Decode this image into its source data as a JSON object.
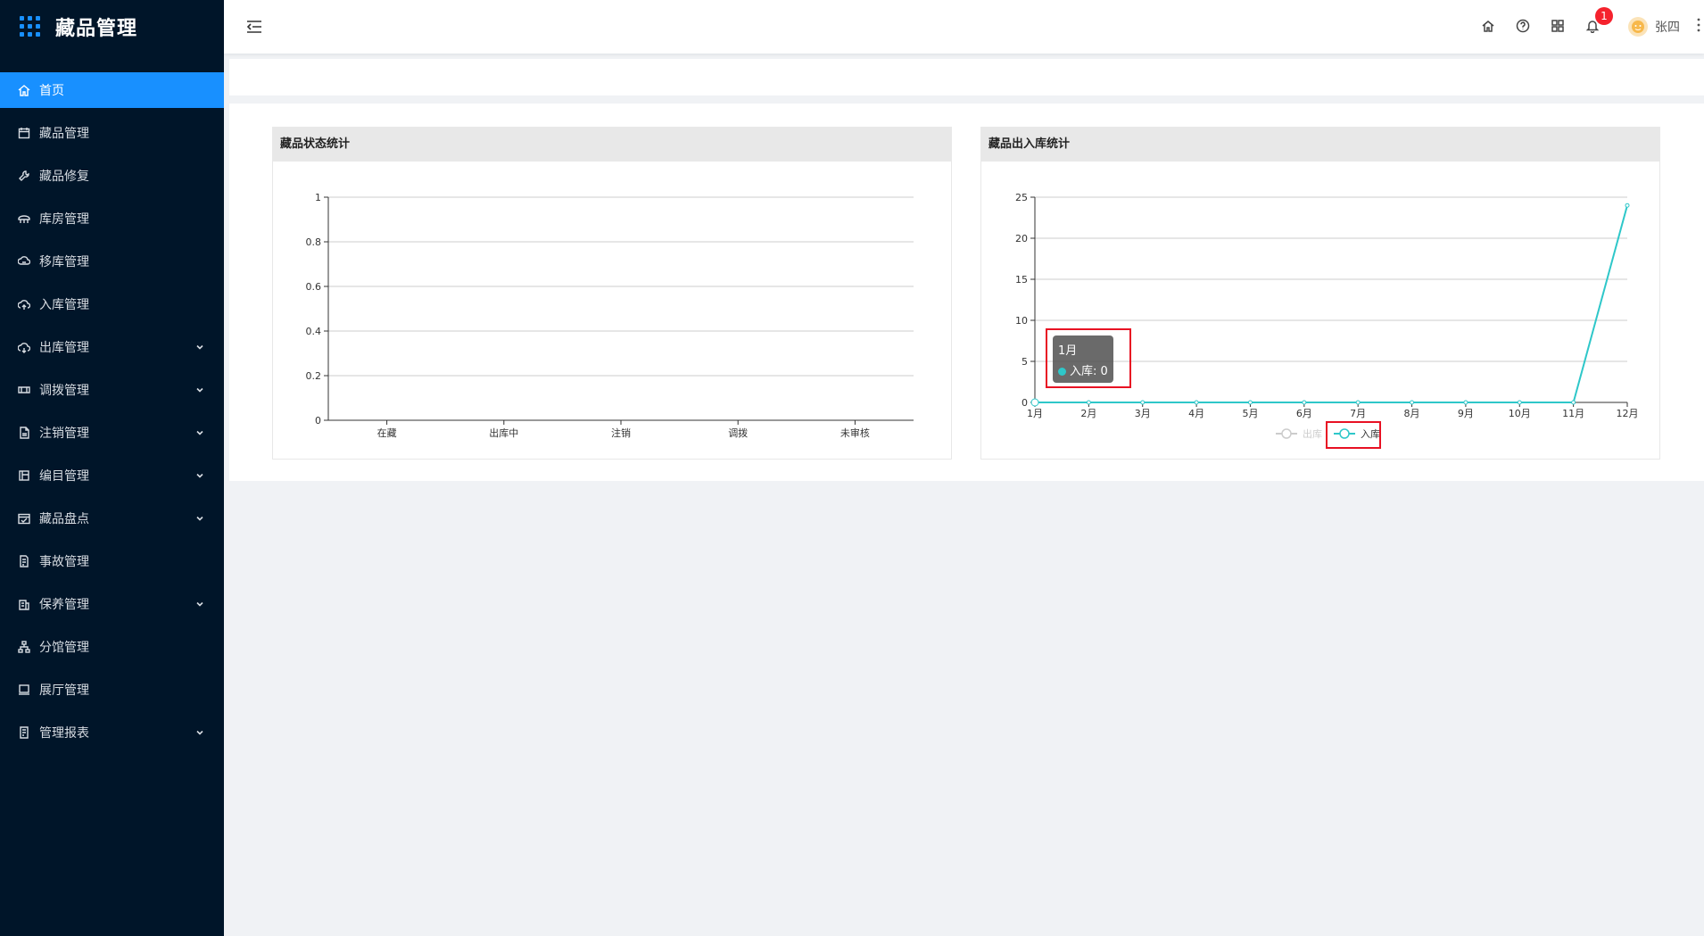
{
  "app": {
    "title": "藏品管理"
  },
  "sidebar": {
    "items": [
      {
        "label": "首页",
        "icon": "home-icon",
        "active": true,
        "expandable": false
      },
      {
        "label": "藏品管理",
        "icon": "calendar-icon",
        "active": false,
        "expandable": false
      },
      {
        "label": "藏品修复",
        "icon": "wrench-icon",
        "active": false,
        "expandable": false
      },
      {
        "label": "库房管理",
        "icon": "warehouse-icon",
        "active": false,
        "expandable": false
      },
      {
        "label": "移库管理",
        "icon": "transfer-cloud-icon",
        "active": false,
        "expandable": false
      },
      {
        "label": "入库管理",
        "icon": "cloud-upload-icon",
        "active": false,
        "expandable": false
      },
      {
        "label": "出库管理",
        "icon": "cloud-download-icon",
        "active": false,
        "expandable": true
      },
      {
        "label": "调拨管理",
        "icon": "swap-icon",
        "active": false,
        "expandable": true
      },
      {
        "label": "注销管理",
        "icon": "document-icon",
        "active": false,
        "expandable": true
      },
      {
        "label": "编目管理",
        "icon": "catalog-icon",
        "active": false,
        "expandable": true
      },
      {
        "label": "藏品盘点",
        "icon": "inventory-icon",
        "active": false,
        "expandable": true
      },
      {
        "label": "事故管理",
        "icon": "incident-icon",
        "active": false,
        "expandable": false
      },
      {
        "label": "保养管理",
        "icon": "maintenance-icon",
        "active": false,
        "expandable": true
      },
      {
        "label": "分馆管理",
        "icon": "branch-icon",
        "active": false,
        "expandable": false
      },
      {
        "label": "展厅管理",
        "icon": "display-icon",
        "active": false,
        "expandable": false
      },
      {
        "label": "管理报表",
        "icon": "report-icon",
        "active": false,
        "expandable": true
      }
    ]
  },
  "header": {
    "icons": [
      "home-icon",
      "help-icon",
      "apps-icon",
      "bell-icon"
    ],
    "notification_count": "1",
    "username": "张四"
  },
  "colors": {
    "sidebar_bg": "#001529",
    "accent": "#1890ff",
    "series_in": "#2ec7c9",
    "highlight": "#e81123"
  },
  "cards": {
    "status": {
      "title": "藏品状态统计"
    },
    "inout": {
      "title": "藏品出入库统计"
    }
  },
  "chart_data": [
    {
      "type": "bar",
      "title": "藏品状态统计",
      "categories": [
        "在藏",
        "出库中",
        "注销",
        "调拨",
        "未审核"
      ],
      "values": [
        0,
        0,
        0,
        0,
        0
      ],
      "yticks": [
        "0",
        "0.2",
        "0.4",
        "0.6",
        "0.8",
        "1"
      ],
      "ylim": [
        0,
        1
      ],
      "grid": true
    },
    {
      "type": "line",
      "title": "藏品出入库统计",
      "categories": [
        "1月",
        "2月",
        "3月",
        "4月",
        "5月",
        "6月",
        "7月",
        "8月",
        "9月",
        "10月",
        "11月",
        "12月"
      ],
      "yticks": [
        "0",
        "5",
        "10",
        "15",
        "20",
        "25"
      ],
      "ylim": [
        0,
        25
      ],
      "grid": true,
      "legend": "bottom-center",
      "series": [
        {
          "name": "出库",
          "values": [],
          "hidden": true
        },
        {
          "name": "入库",
          "values": [
            0,
            0,
            0,
            0,
            0,
            0,
            0,
            0,
            0,
            0,
            0,
            24
          ]
        }
      ],
      "tooltip": {
        "title": "1月",
        "label": "入库: 0"
      }
    }
  ]
}
